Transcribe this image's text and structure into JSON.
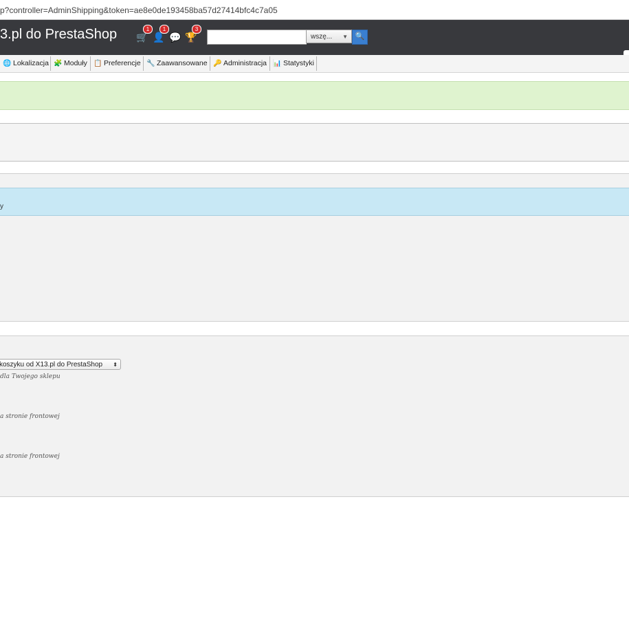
{
  "browser": {
    "url": "p?controller=AdminShipping&token=ae8e0de193458ba57d27414bfc4c7a05"
  },
  "header": {
    "shop_title": "3.pl do PrestaShop",
    "notifications": [
      {
        "icon": "cart-icon",
        "count": "1"
      },
      {
        "icon": "customer-icon",
        "count": "1"
      },
      {
        "icon": "message-icon",
        "count": ""
      },
      {
        "icon": "trophy-icon",
        "count": "3"
      }
    ],
    "search": {
      "value": "",
      "scope_selected": "wszę..."
    }
  },
  "menu": {
    "items": [
      {
        "label": "Lokalizacja",
        "icon": "globe-icon"
      },
      {
        "label": "Moduły",
        "icon": "puzzle-icon"
      },
      {
        "label": "Preferencje",
        "icon": "preferences-icon"
      },
      {
        "label": "Zaawansowane",
        "icon": "wrench-icon"
      },
      {
        "label": "Administracja",
        "icon": "key-icon"
      },
      {
        "label": "Statystyki",
        "icon": "stats-icon"
      }
    ]
  },
  "content": {
    "blue_panel_text": "y",
    "select_value": "koszyku od X13.pl do PrestaShop",
    "hint_1": "dla Twojego sklepu",
    "hint_2": "a stronie frontowej",
    "hint_3": "a stronie frontowej"
  },
  "colors": {
    "header_bg": "#38393d",
    "badge": "#d42b2b",
    "search_button": "#3a7fd0",
    "success_panel": "#dff3cf",
    "info_panel": "#c8e8f5"
  }
}
